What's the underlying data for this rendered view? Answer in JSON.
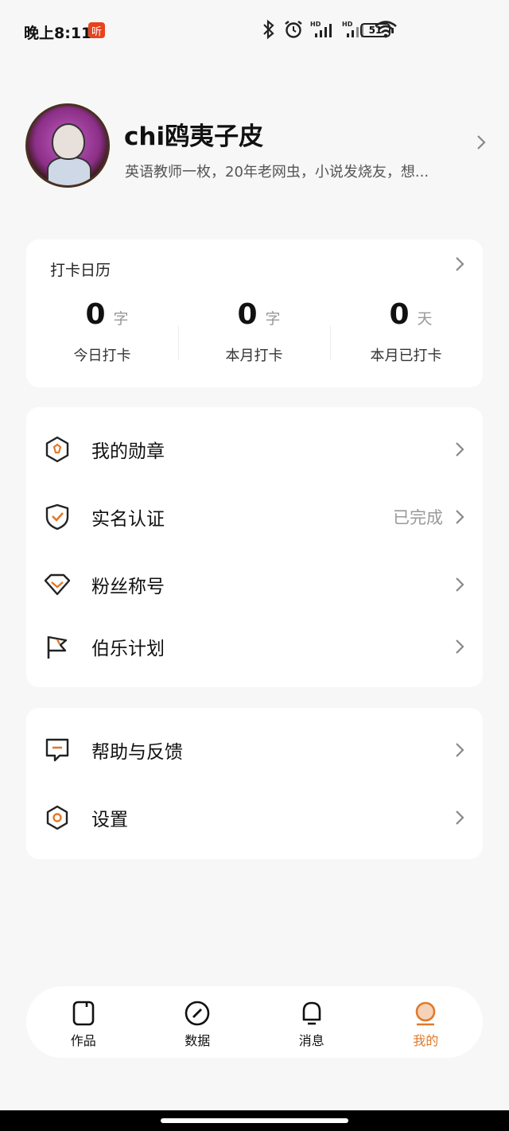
{
  "status_bar": {
    "time": "晚上8:11",
    "app_badge": "听",
    "battery": "51"
  },
  "profile": {
    "name": "chi鸥夷子皮",
    "bio": "英语教师一枚，20年老网虫，小说发烧友，想..."
  },
  "checkin": {
    "title": "打卡日历",
    "stats": [
      {
        "value": "0",
        "unit": "字",
        "label": "今日打卡"
      },
      {
        "value": "0",
        "unit": "字",
        "label": "本月打卡"
      },
      {
        "value": "0",
        "unit": "天",
        "label": "本月已打卡"
      }
    ]
  },
  "menu1": {
    "items": [
      {
        "label": "我的勋章",
        "icon": "medal-icon",
        "value": ""
      },
      {
        "label": "实名认证",
        "icon": "shield-check-icon",
        "value": "已完成"
      },
      {
        "label": "粉丝称号",
        "icon": "diamond-icon",
        "value": ""
      },
      {
        "label": "伯乐计划",
        "icon": "flag-icon",
        "value": ""
      }
    ]
  },
  "menu2": {
    "items": [
      {
        "label": "帮助与反馈",
        "icon": "feedback-icon"
      },
      {
        "label": "设置",
        "icon": "settings-icon"
      }
    ]
  },
  "bottom_nav": {
    "items": [
      {
        "label": "作品",
        "icon": "works-icon",
        "active": false
      },
      {
        "label": "数据",
        "icon": "data-icon",
        "active": false
      },
      {
        "label": "消息",
        "icon": "bell-icon",
        "active": false
      },
      {
        "label": "我的",
        "icon": "profile-icon",
        "active": true
      }
    ]
  },
  "colors": {
    "accent": "#e07a2c",
    "background": "#f7f7f7"
  }
}
